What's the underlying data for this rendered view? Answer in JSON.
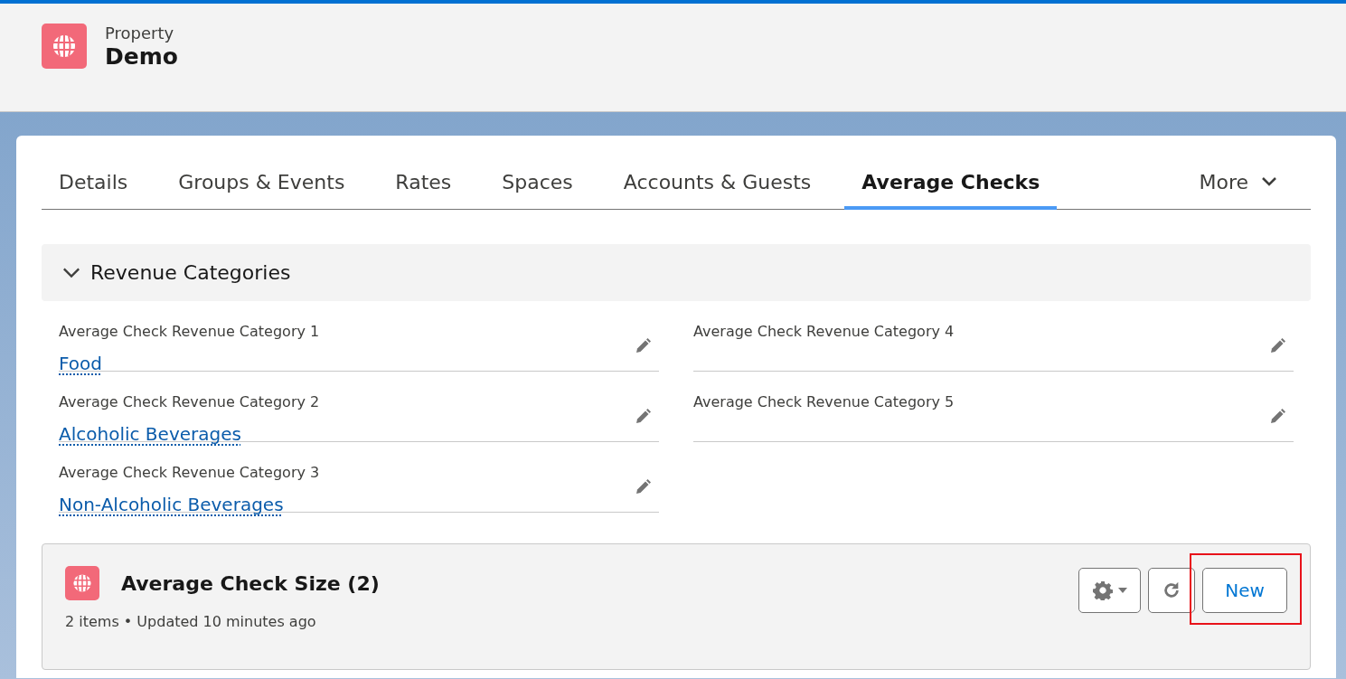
{
  "header": {
    "object_type": "Property",
    "title": "Demo"
  },
  "tabs": [
    {
      "label": "Details",
      "selected": false
    },
    {
      "label": "Groups & Events",
      "selected": false
    },
    {
      "label": "Rates",
      "selected": false
    },
    {
      "label": "Spaces",
      "selected": false
    },
    {
      "label": "Accounts & Guests",
      "selected": false
    },
    {
      "label": "Average Checks",
      "selected": true
    },
    {
      "label": "More",
      "selected": false,
      "kind": "menu"
    }
  ],
  "section": {
    "title": "Revenue Categories",
    "expanded": true,
    "columns": [
      [
        {
          "label": "Average Check Revenue Category 1",
          "value": "Food"
        },
        {
          "label": "Average Check Revenue Category 2",
          "value": "Alcoholic Beverages"
        },
        {
          "label": "Average Check Revenue Category 3",
          "value": "Non-Alcoholic Beverages"
        }
      ],
      [
        {
          "label": "Average Check Revenue Category 4"
        },
        {
          "label": "Average Check Revenue Category 5"
        }
      ]
    ]
  },
  "related_list": {
    "title": "Average Check Size (2)",
    "meta": "2 items • Updated 10 minutes ago",
    "actions": [
      {
        "kind": "settings"
      },
      {
        "kind": "refresh"
      },
      {
        "kind": "text",
        "label": "New",
        "highlighted": true
      }
    ]
  }
}
